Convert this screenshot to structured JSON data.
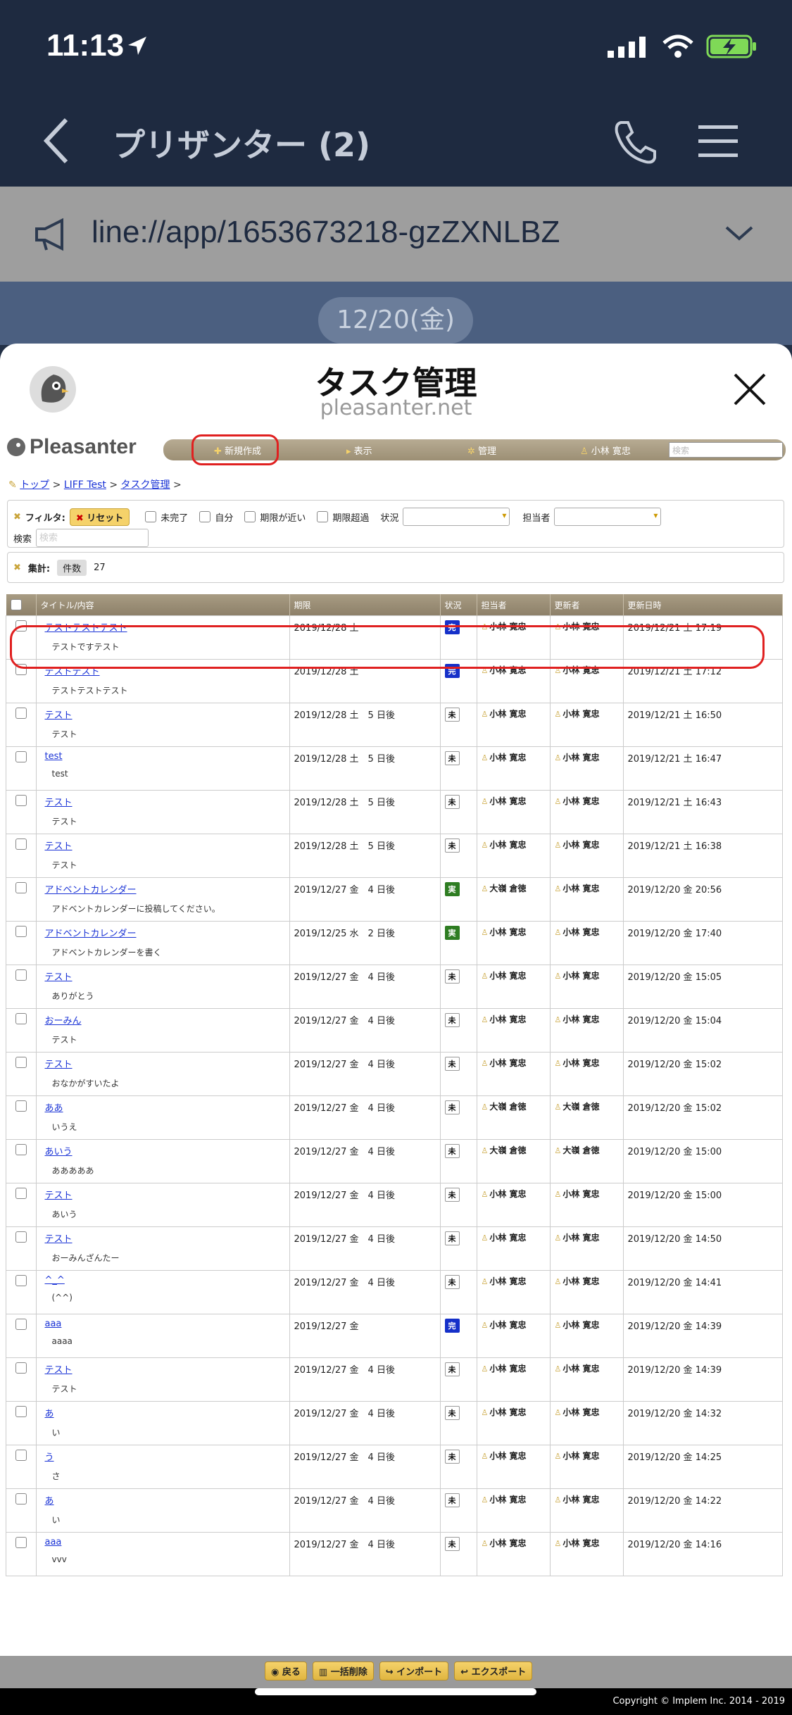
{
  "status": {
    "time": "11:13"
  },
  "chat": {
    "title": "プリザンター (2)",
    "announce_url": "line://app/1653673218-gzZXNLBZ",
    "date_pill": "12/20(金)"
  },
  "liff": {
    "title": "タスク管理",
    "domain": "pleasanter.net"
  },
  "app": {
    "logo_text": "Pleasanter",
    "nav": {
      "new": "新規作成",
      "view": "表示",
      "admin": "管理",
      "user": "小林 寛忠",
      "search_placeholder": "検索"
    },
    "breadcrumb": [
      "トップ",
      "LIFF Test",
      "タスク管理"
    ],
    "filter": {
      "label": "フィルタ:",
      "reset": "リセット",
      "incomplete": "未完了",
      "self": "自分",
      "near_deadline": "期限が近い",
      "overdue": "期限超過",
      "status_label": "状況",
      "assignee_label": "担当者",
      "search_label": "検索",
      "search_placeholder": "検索"
    },
    "summary": {
      "label": "集計:",
      "count_label": "件数",
      "count": "27"
    },
    "columns": [
      "タイトル/内容",
      "期限",
      "状況",
      "担当者",
      "更新者",
      "更新日時"
    ],
    "rows": [
      {
        "title": "テストテストテスト",
        "body": "テストですテスト",
        "due": "2019/12/28 土",
        "status": "完",
        "stype": "done",
        "assignee": "小林 寛忠",
        "updater": "小林 寛忠",
        "updated": "2019/12/21 土 17:19"
      },
      {
        "title": "テストテスト",
        "body": "テストテストテスト",
        "due": "2019/12/28 土",
        "status": "完",
        "stype": "done",
        "assignee": "小林 寛忠",
        "updater": "小林 寛忠",
        "updated": "2019/12/21 土 17:12"
      },
      {
        "title": "テスト",
        "body": "テスト",
        "due": "2019/12/28 土　5 日後",
        "status": "未",
        "stype": "todo",
        "assignee": "小林 寛忠",
        "updater": "小林 寛忠",
        "updated": "2019/12/21 土 16:50"
      },
      {
        "title": "test",
        "body": "test",
        "due": "2019/12/28 土　5 日後",
        "status": "未",
        "stype": "todo",
        "assignee": "小林 寛忠",
        "updater": "小林 寛忠",
        "updated": "2019/12/21 土 16:47"
      },
      {
        "title": "テスト",
        "body": "テスト",
        "due": "2019/12/28 土　5 日後",
        "status": "未",
        "stype": "todo",
        "assignee": "小林 寛忠",
        "updater": "小林 寛忠",
        "updated": "2019/12/21 土 16:43"
      },
      {
        "title": "テスト",
        "body": "テスト",
        "due": "2019/12/28 土　5 日後",
        "status": "未",
        "stype": "todo",
        "assignee": "小林 寛忠",
        "updater": "小林 寛忠",
        "updated": "2019/12/21 土 16:38"
      },
      {
        "title": "アドベントカレンダー",
        "body": "アドベントカレンダーに投稿してください。",
        "due": "2019/12/27 金　4 日後",
        "status": "実",
        "stype": "doing",
        "assignee": "大嶺 倉徳",
        "updater": "小林 寛忠",
        "updated": "2019/12/20 金 20:56"
      },
      {
        "title": "アドベントカレンダー",
        "body": "アドベントカレンダーを書く",
        "due": "2019/12/25 水　2 日後",
        "status": "実",
        "stype": "doing",
        "assignee": "小林 寛忠",
        "updater": "小林 寛忠",
        "updated": "2019/12/20 金 17:40"
      },
      {
        "title": "テスト",
        "body": "ありがとう",
        "due": "2019/12/27 金　4 日後",
        "status": "未",
        "stype": "todo",
        "assignee": "小林 寛忠",
        "updater": "小林 寛忠",
        "updated": "2019/12/20 金 15:05"
      },
      {
        "title": "おーみん",
        "body": "テスト",
        "due": "2019/12/27 金　4 日後",
        "status": "未",
        "stype": "todo",
        "assignee": "小林 寛忠",
        "updater": "小林 寛忠",
        "updated": "2019/12/20 金 15:04"
      },
      {
        "title": "テスト",
        "body": "おなかがすいたよ",
        "due": "2019/12/27 金　4 日後",
        "status": "未",
        "stype": "todo",
        "assignee": "小林 寛忠",
        "updater": "小林 寛忠",
        "updated": "2019/12/20 金 15:02"
      },
      {
        "title": "ああ",
        "body": "いうえ",
        "due": "2019/12/27 金　4 日後",
        "status": "未",
        "stype": "todo",
        "assignee": "大嶺 倉徳",
        "updater": "大嶺 倉徳",
        "updated": "2019/12/20 金 15:02"
      },
      {
        "title": "あいう",
        "body": "あああああ",
        "due": "2019/12/27 金　4 日後",
        "status": "未",
        "stype": "todo",
        "assignee": "大嶺 倉徳",
        "updater": "大嶺 倉徳",
        "updated": "2019/12/20 金 15:00"
      },
      {
        "title": "テスト",
        "body": "あいう",
        "due": "2019/12/27 金　4 日後",
        "status": "未",
        "stype": "todo",
        "assignee": "小林 寛忠",
        "updater": "小林 寛忠",
        "updated": "2019/12/20 金 15:00"
      },
      {
        "title": "テスト",
        "body": "おーみんざんたー",
        "due": "2019/12/27 金　4 日後",
        "status": "未",
        "stype": "todo",
        "assignee": "小林 寛忠",
        "updater": "小林 寛忠",
        "updated": "2019/12/20 金 14:50"
      },
      {
        "title": "^_^",
        "body": "(^^)",
        "due": "2019/12/27 金　4 日後",
        "status": "未",
        "stype": "todo",
        "assignee": "小林 寛忠",
        "updater": "小林 寛忠",
        "updated": "2019/12/20 金 14:41"
      },
      {
        "title": "aaa",
        "body": "aaaa",
        "due": "2019/12/27 金",
        "status": "完",
        "stype": "done",
        "assignee": "小林 寛忠",
        "updater": "小林 寛忠",
        "updated": "2019/12/20 金 14:39"
      },
      {
        "title": "テスト",
        "body": "テスト",
        "due": "2019/12/27 金　4 日後",
        "status": "未",
        "stype": "todo",
        "assignee": "小林 寛忠",
        "updater": "小林 寛忠",
        "updated": "2019/12/20 金 14:39"
      },
      {
        "title": "あ",
        "body": "い",
        "due": "2019/12/27 金　4 日後",
        "status": "未",
        "stype": "todo",
        "assignee": "小林 寛忠",
        "updater": "小林 寛忠",
        "updated": "2019/12/20 金 14:32"
      },
      {
        "title": "う",
        "body": "さ",
        "due": "2019/12/27 金　4 日後",
        "status": "未",
        "stype": "todo",
        "assignee": "小林 寛忠",
        "updater": "小林 寛忠",
        "updated": "2019/12/20 金 14:25"
      },
      {
        "title": "あ",
        "body": "い",
        "due": "2019/12/27 金　4 日後",
        "status": "未",
        "stype": "todo",
        "assignee": "小林 寛忠",
        "updater": "小林 寛忠",
        "updated": "2019/12/20 金 14:22"
      },
      {
        "title": "aaa",
        "body": "vvv",
        "due": "2019/12/27 金　4 日後",
        "status": "未",
        "stype": "todo",
        "assignee": "小林 寛忠",
        "updater": "小林 寛忠",
        "updated": "2019/12/20 金 14:16"
      }
    ],
    "bottom_buttons": [
      "戻る",
      "一括削除",
      "インポート",
      "エクスポート"
    ],
    "copyright": "Copyright © Implem Inc. 2014 - 2019"
  },
  "colors": {
    "header_bg": "#1e2a40",
    "table_header": "#9c8f74",
    "accent_yellow": "#f5d26a",
    "annotation_red": "#e02020",
    "status_done": "#1530c9",
    "status_doing": "#2e7d22"
  }
}
